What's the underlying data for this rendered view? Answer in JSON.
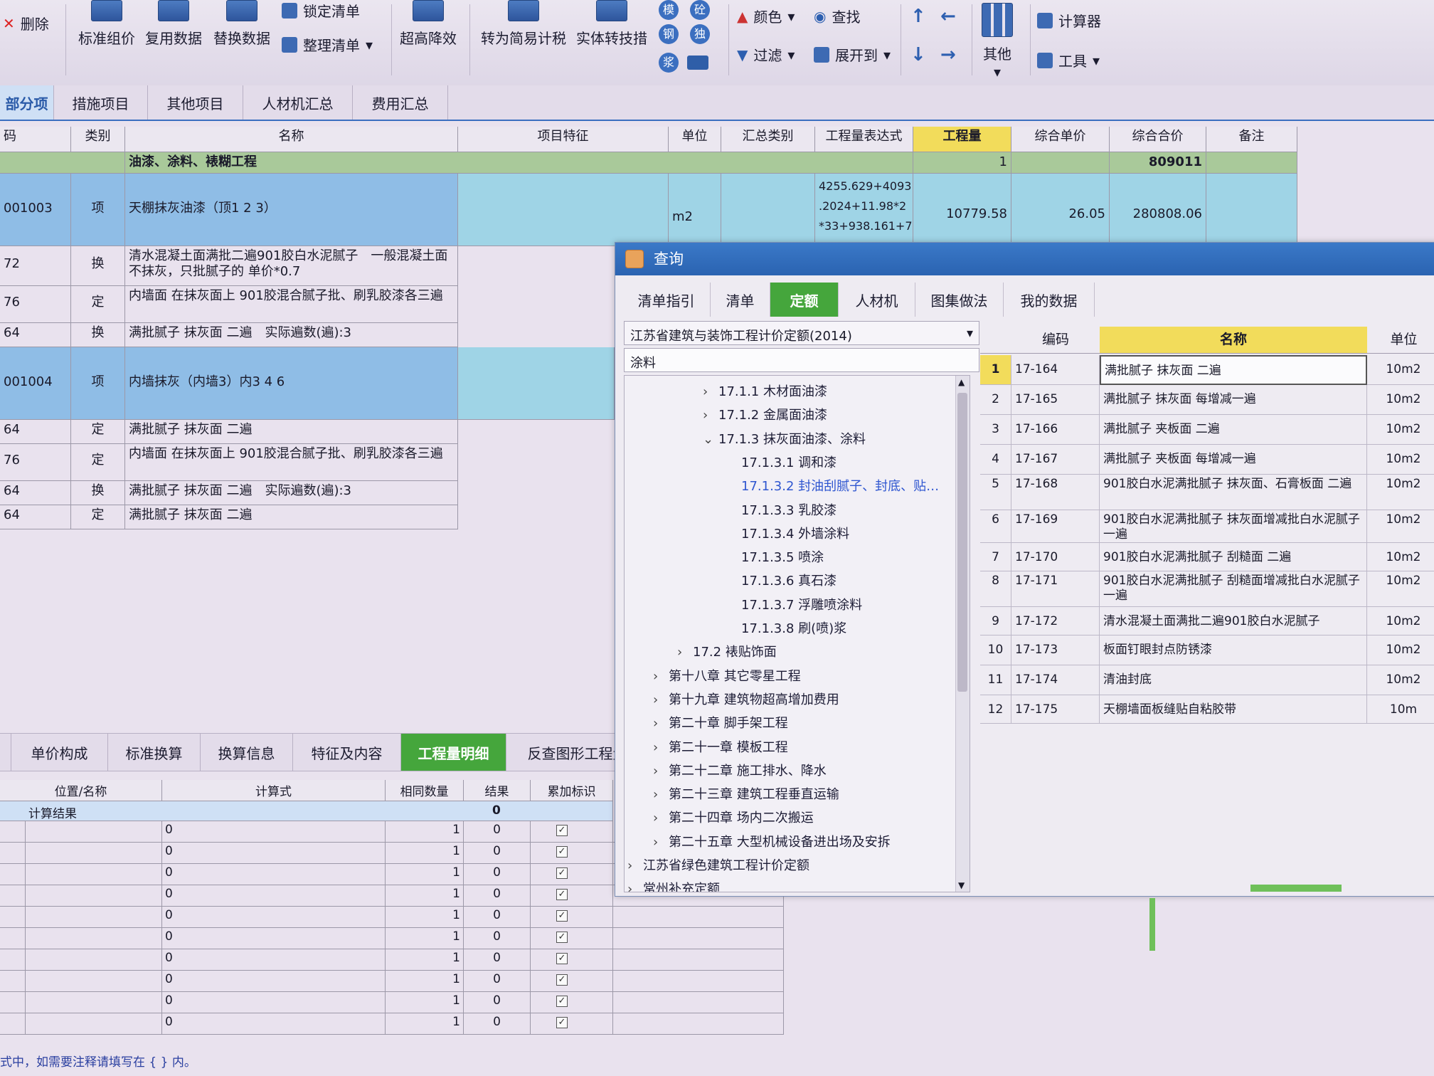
{
  "toolbar": {
    "delete": "删除",
    "std_price": "标准组价",
    "reuse": "复用数据",
    "replace": "替换数据",
    "lock_list": "锁定清单",
    "organize_list": "整理清单",
    "super_height": "超高降效",
    "to_simple": "转为简易计税",
    "entity_to_measure": "实体转技措",
    "mini_icons": [
      "模",
      "砼",
      "钢",
      "独",
      "浆"
    ],
    "color": "颜色",
    "find": "查找",
    "filter": "过滤",
    "expand_to": "展开到",
    "other": "其他",
    "calculator": "计算器",
    "tools": "工具"
  },
  "main_tabs": [
    "部分项",
    "措施项目",
    "其他项目",
    "人材机汇总",
    "费用汇总"
  ],
  "grid": {
    "headers": {
      "code": "码",
      "type": "类别",
      "name": "名称",
      "feature": "项目特征",
      "unit": "单位",
      "summary": "汇总类别",
      "expr": "工程量表达式",
      "qty": "工程量",
      "unit_price": "综合单价",
      "total_price": "综合合价",
      "remark": "备注"
    },
    "group": {
      "name": "油漆、涂料、裱糊工程",
      "qty": "1",
      "total": "809011"
    },
    "rows": [
      {
        "code": "001003",
        "type": "项",
        "name": "天棚抹灰油漆（顶1 2 3）",
        "unit": "m2",
        "expr1": "4255.629+4093",
        "expr2": ".2024+11.98*2",
        "expr3": "*33+938.161+7",
        "qty": "10779.58",
        "unit_price": "26.05",
        "total": "280808.06"
      },
      {
        "code": "72",
        "type": "换",
        "name": "清水混凝土面满批二遍901胶白水泥腻子　一般混凝土面不抹灰，只批腻子的 单价*0.7"
      },
      {
        "code": "76",
        "type": "定",
        "name": "内墙面 在抹灰面上 901胶混合腻子批、刷乳胶漆各三遍"
      },
      {
        "code": "64",
        "type": "换",
        "name": "满批腻子 抹灰面 二遍　实际遍数(遍):3"
      },
      {
        "code": "001004",
        "type": "项",
        "name": "内墙抹灰（内墙3）内3 4 6"
      },
      {
        "code": "64",
        "type": "定",
        "name": "满批腻子 抹灰面 二遍"
      },
      {
        "code": "76",
        "type": "定",
        "name": "内墙面 在抹灰面上 901胶混合腻子批、刷乳胶漆各三遍"
      },
      {
        "code": "64",
        "type": "换",
        "name": "满批腻子 抹灰面 二遍　实际遍数(遍):3"
      },
      {
        "code": "64",
        "type": "定",
        "name": "满批腻子 抹灰面 二遍"
      }
    ]
  },
  "bottom": {
    "tabs": [
      "单价构成",
      "标准换算",
      "换算信息",
      "特征及内容",
      "工程量明细",
      "反查图形工程量"
    ],
    "headers": {
      "pos": "位置/名称",
      "formula": "计算式",
      "same": "相同数量",
      "result": "结果",
      "accum": "累加标识"
    },
    "calc_label": "计算结果",
    "calc_value": "0",
    "rows": [
      {
        "f": "0",
        "s": "1",
        "r": "0"
      },
      {
        "f": "0",
        "s": "1",
        "r": "0"
      },
      {
        "f": "0",
        "s": "1",
        "r": "0"
      },
      {
        "f": "0",
        "s": "1",
        "r": "0"
      },
      {
        "f": "0",
        "s": "1",
        "r": "0"
      },
      {
        "f": "0",
        "s": "1",
        "r": "0"
      },
      {
        "f": "0",
        "s": "1",
        "r": "0"
      },
      {
        "f": "0",
        "s": "1",
        "r": "0"
      },
      {
        "f": "0",
        "s": "1",
        "r": "0"
      },
      {
        "f": "0",
        "s": "1",
        "r": "0"
      }
    ],
    "status": "式中，如需要注释请填写在 { } 内。"
  },
  "dialog": {
    "title": "查询",
    "tabs": [
      "清单指引",
      "清单",
      "定额",
      "人材机",
      "图集做法",
      "我的数据"
    ],
    "active_tab": "定额",
    "library": "江苏省建筑与装饰工程计价定额(2014)",
    "search": "涂料",
    "tree": [
      {
        "label": "17.1.1 木材面油漆",
        "chev": "›"
      },
      {
        "label": "17.1.2 金属面油漆",
        "chev": "›"
      },
      {
        "label": "17.1.3 抹灰面油漆、涂料",
        "chev": "⌄"
      },
      {
        "label": "17.1.3.1 调和漆",
        "chev": ""
      },
      {
        "label": "17.1.3.2 封油刮腻子、封底、贴…",
        "chev": ""
      },
      {
        "label": "17.1.3.3 乳胶漆",
        "chev": ""
      },
      {
        "label": "17.1.3.4 外墙涂料",
        "chev": ""
      },
      {
        "label": "17.1.3.5 喷涂",
        "chev": ""
      },
      {
        "label": "17.1.3.6 真石漆",
        "chev": ""
      },
      {
        "label": "17.1.3.7 浮雕喷涂料",
        "chev": ""
      },
      {
        "label": "17.1.3.8 刷(喷)浆",
        "chev": ""
      },
      {
        "label": "17.2 裱贴饰面",
        "chev": "›"
      },
      {
        "label": "第十八章 其它零星工程",
        "chev": "›"
      },
      {
        "label": "第十九章 建筑物超高增加费用",
        "chev": "›"
      },
      {
        "label": "第二十章 脚手架工程",
        "chev": "›"
      },
      {
        "label": "第二十一章 模板工程",
        "chev": "›"
      },
      {
        "label": "第二十二章 施工排水、降水",
        "chev": "›"
      },
      {
        "label": "第二十三章 建筑工程垂直运输",
        "chev": "›"
      },
      {
        "label": "第二十四章 场内二次搬运",
        "chev": "›"
      },
      {
        "label": "第二十五章 大型机械设备进出场及安拆",
        "chev": "›"
      },
      {
        "label": "江苏省绿色建筑工程计价定额",
        "chev": "›"
      },
      {
        "label": "常州补充定额",
        "chev": "›"
      }
    ],
    "result_headers": {
      "code": "编码",
      "name": "名称",
      "unit": "单位"
    },
    "results": [
      {
        "n": "1",
        "code": "17-164",
        "name": "满批腻子 抹灰面 二遍",
        "unit": "10m2"
      },
      {
        "n": "2",
        "code": "17-165",
        "name": "满批腻子 抹灰面 每增减一遍",
        "unit": "10m2"
      },
      {
        "n": "3",
        "code": "17-166",
        "name": "满批腻子 夹板面 二遍",
        "unit": "10m2"
      },
      {
        "n": "4",
        "code": "17-167",
        "name": "满批腻子 夹板面 每增减一遍",
        "unit": "10m2"
      },
      {
        "n": "5",
        "code": "17-168",
        "name": "901胶白水泥满批腻子 抹灰面、石膏板面 二遍",
        "unit": "10m2"
      },
      {
        "n": "6",
        "code": "17-169",
        "name": "901胶白水泥满批腻子 抹灰面增减批白水泥腻子 一遍",
        "unit": "10m2"
      },
      {
        "n": "7",
        "code": "17-170",
        "name": "901胶白水泥满批腻子 刮糙面 二遍",
        "unit": "10m2"
      },
      {
        "n": "8",
        "code": "17-171",
        "name": "901胶白水泥满批腻子 刮糙面增减批白水泥腻子 一遍",
        "unit": "10m2"
      },
      {
        "n": "9",
        "code": "17-172",
        "name": "清水混凝土面满批二遍901胶白水泥腻子",
        "unit": "10m2"
      },
      {
        "n": "10",
        "code": "17-173",
        "name": "板面钉眼封点防锈漆",
        "unit": "10m2"
      },
      {
        "n": "11",
        "code": "17-174",
        "name": "清油封底",
        "unit": "10m2"
      },
      {
        "n": "12",
        "code": "17-175",
        "name": "天棚墙面板缝贴自粘胶带",
        "unit": "10m"
      }
    ]
  },
  "colors": {
    "group_row": "#a9c99a",
    "selected_row": "#8fbde6",
    "qty_header": "#f2dc5b",
    "active_tab": "#45a63c",
    "dialog_title": "#2f6bb8"
  }
}
